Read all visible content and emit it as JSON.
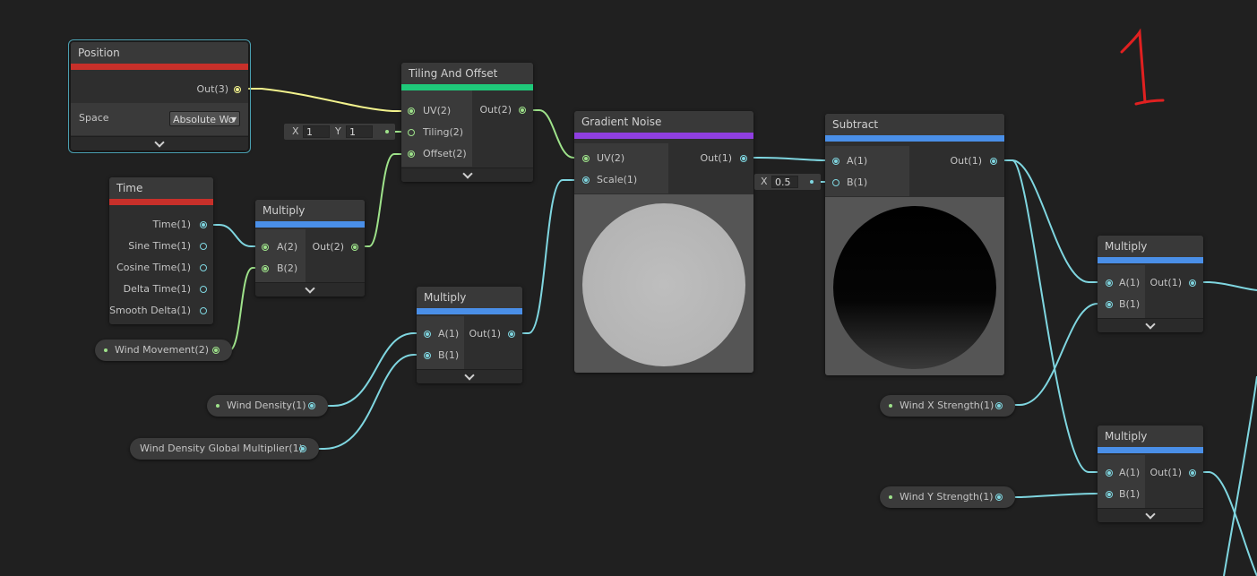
{
  "annotation": {
    "text": "1",
    "color": "#e02020"
  },
  "nodes": {
    "position": {
      "title": "Position",
      "out": "Out(3)",
      "space_label": "Space",
      "space_value": "Absolute Wo",
      "bar_color": "#c8302a"
    },
    "tiling": {
      "title": "Tiling And Offset",
      "inputs": [
        "UV(2)",
        "Tiling(2)",
        "Offset(2)"
      ],
      "out": "Out(2)",
      "bar_color": "#1fc97a",
      "tiling_x_label": "X",
      "tiling_x": "1",
      "tiling_y_label": "Y",
      "tiling_y": "1"
    },
    "time": {
      "title": "Time",
      "outputs": [
        "Time(1)",
        "Sine Time(1)",
        "Cosine Time(1)",
        "Delta Time(1)",
        "Smooth Delta(1)"
      ],
      "bar_color": "#c8302a"
    },
    "multiply1": {
      "title": "Multiply",
      "inputs": [
        "A(2)",
        "B(2)"
      ],
      "out": "Out(2)",
      "bar_color": "#4a8fe8"
    },
    "multiply2": {
      "title": "Multiply",
      "inputs": [
        "A(1)",
        "B(1)"
      ],
      "out": "Out(1)",
      "bar_color": "#4a8fe8"
    },
    "gradient": {
      "title": "Gradient Noise",
      "inputs": [
        "UV(2)",
        "Scale(1)"
      ],
      "out": "Out(1)",
      "bar_color": "#8f3fe0"
    },
    "subtract": {
      "title": "Subtract",
      "inputs": [
        "A(1)",
        "B(1)"
      ],
      "out": "Out(1)",
      "bar_color": "#4a8fe8",
      "b_label": "X",
      "b_value": "0.5"
    },
    "multiply3": {
      "title": "Multiply",
      "inputs": [
        "A(1)",
        "B(1)"
      ],
      "out": "Out(1)",
      "bar_color": "#4a8fe8"
    },
    "multiply4": {
      "title": "Multiply",
      "inputs": [
        "A(1)",
        "B(1)"
      ],
      "out": "Out(1)",
      "bar_color": "#4a8fe8"
    }
  },
  "properties": {
    "wind_movement": "Wind Movement(2)",
    "wind_density": "Wind Density(1)",
    "wind_density_global": "Wind Density Global Multiplier(1)",
    "wind_x": "Wind X Strength(1)",
    "wind_y": "Wind Y Strength(1)"
  },
  "colors": {
    "wire_float": "#7fd6e0",
    "wire_vec2": "#9ee28a",
    "wire_vec3": "#f3f38d",
    "canvas": "#202020"
  }
}
